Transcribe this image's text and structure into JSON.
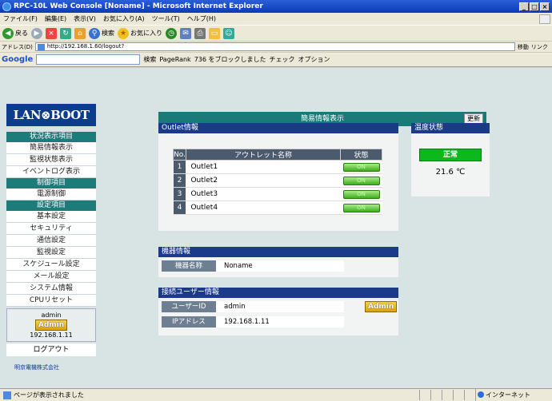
{
  "window": {
    "title": "RPC-10L Web Console [Noname] - Microsoft Internet Explorer",
    "controls": [
      "_",
      "□",
      "×"
    ]
  },
  "menubar": [
    "ファイル(F)",
    "編集(E)",
    "表示(V)",
    "お気に入り(A)",
    "ツール(T)",
    "ヘルプ(H)"
  ],
  "toolbar": {
    "back": "戻る",
    "search": "検索",
    "favorites": "お気に入り"
  },
  "address": {
    "label": "アドレス(D)",
    "url": "http://192.168.1.60/logout?",
    "go": "移動",
    "links": "リンク"
  },
  "googlebar": {
    "logo": "Google",
    "search": "検索",
    "pagerank": "PageRank",
    "blocked": "736 をブロックしました",
    "check": "チェック",
    "options": "オプション"
  },
  "sidebar": {
    "logo": "LAN⊗BOOT",
    "sections": [
      {
        "header": "状況表示項目",
        "items": [
          "簡易情報表示",
          "監視状態表示",
          "イベントログ表示"
        ]
      },
      {
        "header": "制御項目",
        "items": [
          "電源制御"
        ]
      },
      {
        "header": "設定項目",
        "items": [
          "基本設定",
          "セキュリティ",
          "通信設定",
          "監視設定",
          "スケジュール設定",
          "メール設定",
          "システム情報",
          "CPUリセット"
        ]
      }
    ],
    "user": {
      "name": "admin",
      "badge": "Admin",
      "ip": "192.168.1.11"
    },
    "logout": "ログアウト",
    "company": "明京電機株式会社"
  },
  "page": {
    "title": "簡易情報表示",
    "refresh": "更新"
  },
  "outlet": {
    "header": "Outlet情報",
    "columns": [
      "No.",
      "アウトレット名称",
      "状態"
    ],
    "rows": [
      {
        "no": "1",
        "name": "Outlet1",
        "state": "ON"
      },
      {
        "no": "2",
        "name": "Outlet2",
        "state": "ON"
      },
      {
        "no": "3",
        "name": "Outlet3",
        "state": "ON"
      },
      {
        "no": "4",
        "name": "Outlet4",
        "state": "ON"
      }
    ]
  },
  "temperature": {
    "header": "温度状態",
    "status": "正常",
    "value": "21.6 ℃"
  },
  "device": {
    "header": "機器情報",
    "name_label": "機器名称",
    "name_value": "Noname"
  },
  "connection": {
    "header": "接続ユーザー情報",
    "user_label": "ユーザーID",
    "user_value": "admin",
    "badge": "Admin",
    "ip_label": "IPアドレス",
    "ip_value": "192.168.1.11"
  },
  "statusbar": {
    "text": "ページが表示されました",
    "zone": "インターネット"
  }
}
